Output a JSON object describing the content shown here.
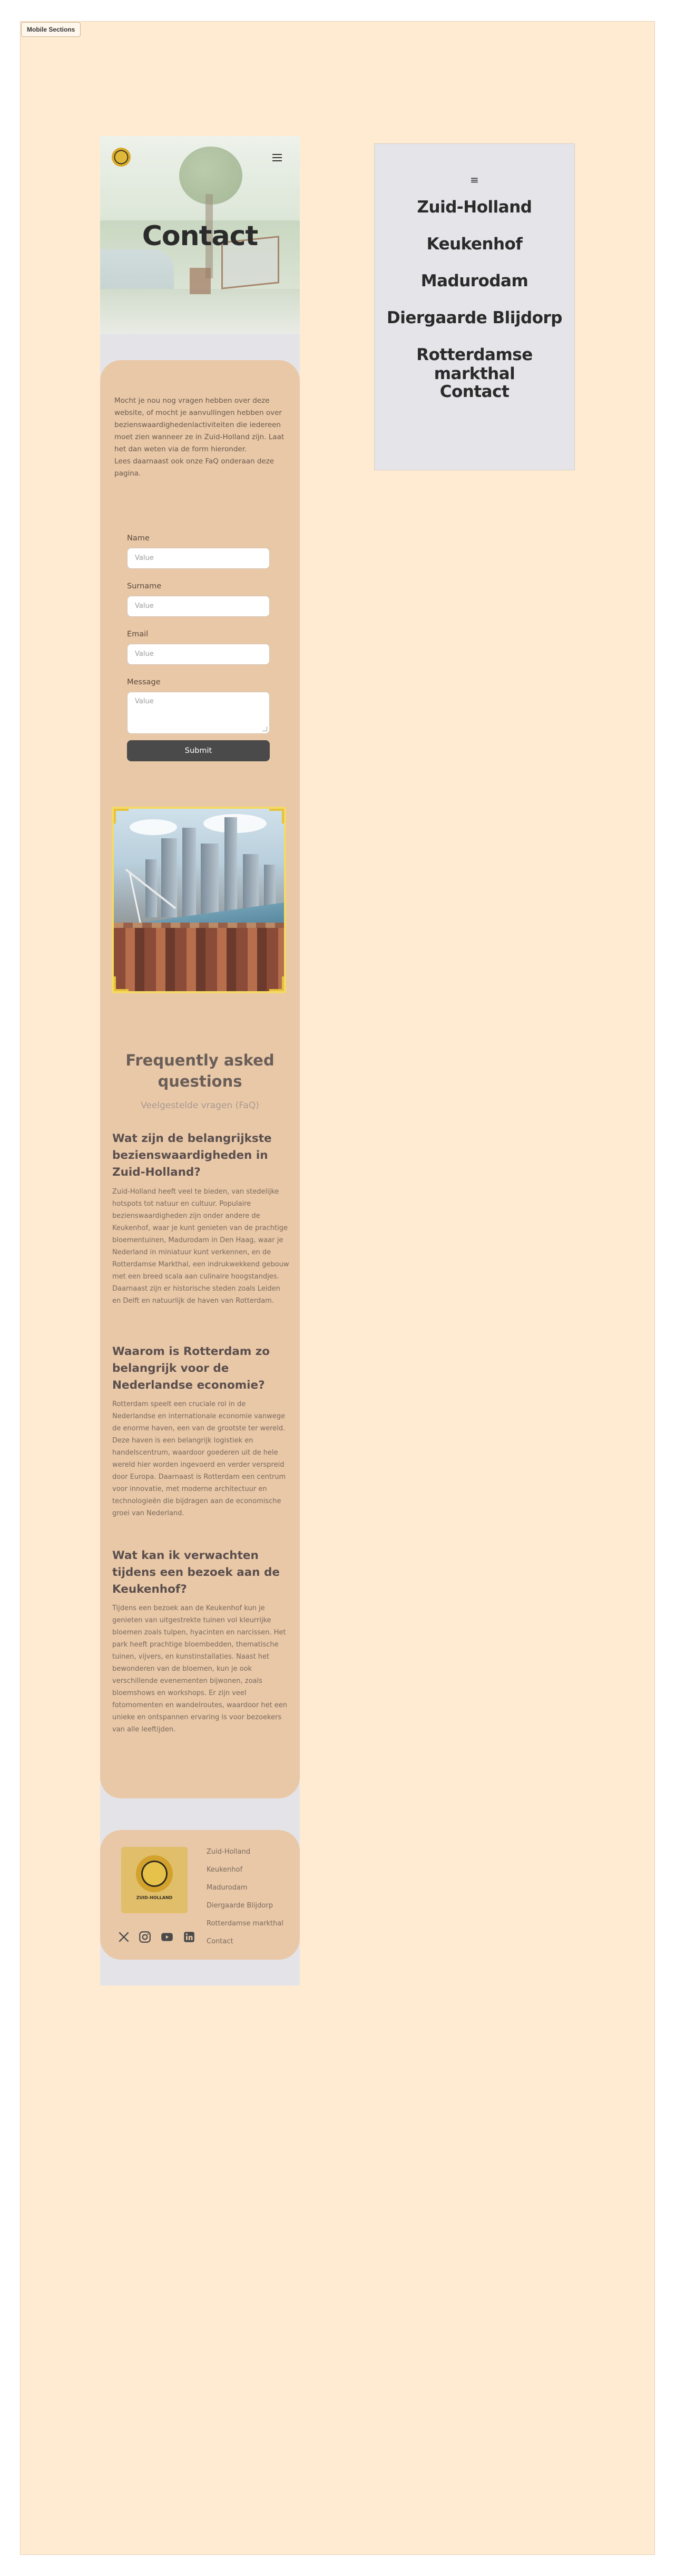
{
  "section_tag": "Mobile Sections",
  "hero": {
    "title": "Contact"
  },
  "intro_text": "Mocht je nou nog vragen hebben over deze website, of mocht je aanvullingen hebben over bezienswaardighedenlactiviteiten die iedereen moet zien wanneer ze in Zuid-Holland zijn. Laat het dan weten via de form hieronder.\nLees daarnaast ook onze FaQ onderaan deze pagina.",
  "form": {
    "name_label": "Name",
    "name_placeholder": "Value",
    "surname_label": "Surname",
    "surname_placeholder": "Value",
    "email_label": "Email",
    "email_placeholder": "Value",
    "message_label": "Message",
    "message_placeholder": "Value",
    "submit_label": "Submit"
  },
  "faq": {
    "title": "Frequently asked questions",
    "subtitle": "Veelgestelde vragen (FaQ)",
    "items": [
      {
        "question": "Wat zijn de belangrijkste bezienswaardigheden in Zuid-Holland?",
        "answer": "Zuid-Holland heeft veel te bieden, van stedelijke hotspots tot natuur en cultuur. Populaire bezienswaardigheden zijn onder andere de Keukenhof, waar je kunt genieten van de prachtige bloementuinen, Madurodam in Den Haag, waar je Nederland in miniatuur kunt verkennen, en de Rotterdamse Markthal, een indrukwekkend gebouw met een breed scala aan culinaire hoogstandjes. Daarnaast zijn er historische steden zoals Leiden en Delft en natuurlijk de haven van Rotterdam."
      },
      {
        "question": "Waarom is Rotterdam zo belangrijk voor de Nederlandse economie?",
        "answer": "Rotterdam speelt een cruciale rol in de Nederlandse en internationale economie vanwege de enorme haven, een van de grootste ter wereld. Deze haven is een belangrijk logistiek en handelscentrum, waardoor goederen uit de hele wereld hier worden ingevoerd en verder verspreid door Europa. Daarnaast is Rotterdam een centrum voor innovatie, met moderne architectuur en technologieën die bijdragen aan de economische groei van Nederland."
      },
      {
        "question": "Wat kan ik verwachten tijdens een bezoek aan de Keukenhof?",
        "answer": "Tijdens een bezoek aan de Keukenhof kun je genieten van uitgestrekte tuinen vol kleurrijke bloemen zoals tulpen, hyacinten en narcissen. Het park heeft prachtige bloembedden, thematische tuinen, vijvers, en kunstinstallaties. Naast het bewonderen van de bloemen, kun je ook verschillende evenementen bijwonen, zoals bloemshows en workshops. Er zijn veel fotomomenten en wandelroutes, waardoor het een unieke en ontspannen ervaring is voor bezoekers van alle leeftijden."
      }
    ]
  },
  "footer": {
    "logo_text": "ZUID-HOLLAND",
    "links": [
      "Zuid-Holland",
      "Keukenhof",
      "Madurodam",
      "Diergaarde Blijdorp",
      "Rotterdamse markthal",
      "Contact"
    ],
    "socials": [
      "x-icon",
      "instagram-icon",
      "youtube-icon",
      "linkedin-icon"
    ]
  },
  "nav_panel": {
    "menu_glyph": "≡",
    "items": [
      "Zuid-Holland",
      "Keukenhof",
      "Madurodam",
      "Diergaarde Blijdorp",
      "Rotterdamse markthal",
      "Contact"
    ]
  }
}
